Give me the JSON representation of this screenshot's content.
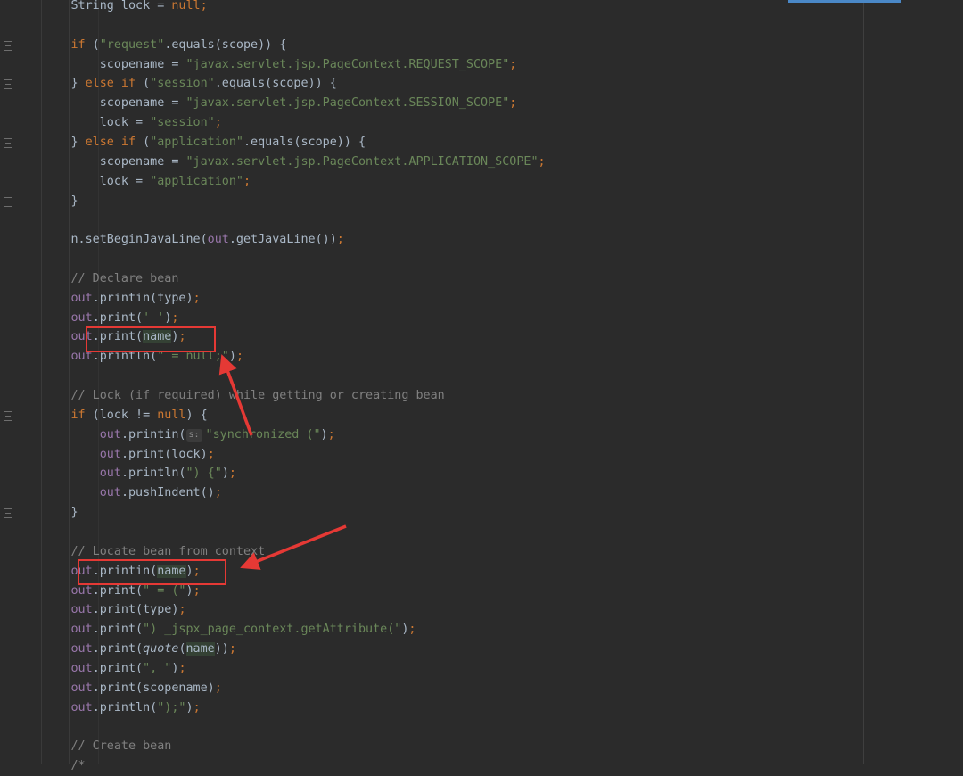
{
  "editor": {
    "language": "java",
    "theme_colors": {
      "background": "#2b2b2b",
      "keyword": "#cc7832",
      "string": "#6a8759",
      "field": "#9876aa",
      "comment": "#808080",
      "plain": "#a9b7c6",
      "annotation": "#e53935"
    },
    "lines": [
      {
        "fold": false,
        "tokens": [
          {
            "t": "plain",
            "v": "        String lock = "
          },
          {
            "t": "kw",
            "v": "null"
          },
          {
            "t": "kw",
            "v": ";"
          }
        ]
      },
      {
        "fold": false,
        "tokens": []
      },
      {
        "fold": true,
        "tokens": [
          {
            "t": "plain",
            "v": "        "
          },
          {
            "t": "kw",
            "v": "if"
          },
          {
            "t": "plain",
            "v": " ("
          },
          {
            "t": "str",
            "v": "\"request\""
          },
          {
            "t": "plain",
            "v": ".equals(scope)) {"
          }
        ]
      },
      {
        "fold": false,
        "tokens": [
          {
            "t": "plain",
            "v": "            scopename = "
          },
          {
            "t": "str",
            "v": "\"javax.servlet.jsp.PageContext.REQUEST_SCOPE\""
          },
          {
            "t": "kw",
            "v": ";"
          }
        ]
      },
      {
        "fold": true,
        "tokens": [
          {
            "t": "plain",
            "v": "        } "
          },
          {
            "t": "kw",
            "v": "else if"
          },
          {
            "t": "plain",
            "v": " ("
          },
          {
            "t": "str",
            "v": "\"session\""
          },
          {
            "t": "plain",
            "v": ".equals(scope)) {"
          }
        ]
      },
      {
        "fold": false,
        "tokens": [
          {
            "t": "plain",
            "v": "            scopename = "
          },
          {
            "t": "str",
            "v": "\"javax.servlet.jsp.PageContext.SESSION_SCOPE\""
          },
          {
            "t": "kw",
            "v": ";"
          }
        ]
      },
      {
        "fold": false,
        "tokens": [
          {
            "t": "plain",
            "v": "            lock = "
          },
          {
            "t": "str",
            "v": "\"session\""
          },
          {
            "t": "kw",
            "v": ";"
          }
        ]
      },
      {
        "fold": true,
        "tokens": [
          {
            "t": "plain",
            "v": "        } "
          },
          {
            "t": "kw",
            "v": "else if"
          },
          {
            "t": "plain",
            "v": " ("
          },
          {
            "t": "str",
            "v": "\"application\""
          },
          {
            "t": "plain",
            "v": ".equals(scope)) {"
          }
        ]
      },
      {
        "fold": false,
        "tokens": [
          {
            "t": "plain",
            "v": "            scopename = "
          },
          {
            "t": "str",
            "v": "\"javax.servlet.jsp.PageContext.APPLICATION_SCOPE\""
          },
          {
            "t": "kw",
            "v": ";"
          }
        ]
      },
      {
        "fold": false,
        "tokens": [
          {
            "t": "plain",
            "v": "            lock = "
          },
          {
            "t": "str",
            "v": "\"application\""
          },
          {
            "t": "kw",
            "v": ";"
          }
        ]
      },
      {
        "fold": true,
        "tokens": [
          {
            "t": "plain",
            "v": "        }"
          }
        ]
      },
      {
        "fold": false,
        "tokens": []
      },
      {
        "fold": false,
        "tokens": [
          {
            "t": "plain",
            "v": "        n.setBeginJavaLine("
          },
          {
            "t": "field",
            "v": "out"
          },
          {
            "t": "plain",
            "v": ".getJavaLine())"
          },
          {
            "t": "kw",
            "v": ";"
          }
        ]
      },
      {
        "fold": false,
        "tokens": []
      },
      {
        "fold": false,
        "tokens": [
          {
            "t": "comment",
            "v": "        // Declare bean"
          }
        ]
      },
      {
        "fold": false,
        "tokens": [
          {
            "t": "plain",
            "v": "        "
          },
          {
            "t": "field",
            "v": "out"
          },
          {
            "t": "plain",
            "v": ".printin(type)"
          },
          {
            "t": "kw",
            "v": ";"
          }
        ]
      },
      {
        "fold": false,
        "tokens": [
          {
            "t": "plain",
            "v": "        "
          },
          {
            "t": "field",
            "v": "out"
          },
          {
            "t": "plain",
            "v": ".print("
          },
          {
            "t": "str",
            "v": "' '"
          },
          {
            "t": "plain",
            "v": ")"
          },
          {
            "t": "kw",
            "v": ";"
          }
        ]
      },
      {
        "fold": false,
        "tokens": [
          {
            "t": "plain",
            "v": "        "
          },
          {
            "t": "field",
            "v": "out"
          },
          {
            "t": "plain",
            "v": ".print("
          },
          {
            "t": "hl",
            "v": "name"
          },
          {
            "t": "plain",
            "v": ")"
          },
          {
            "t": "kw",
            "v": ";"
          }
        ]
      },
      {
        "fold": false,
        "tokens": [
          {
            "t": "plain",
            "v": "        "
          },
          {
            "t": "field",
            "v": "out"
          },
          {
            "t": "plain",
            "v": ".println("
          },
          {
            "t": "str",
            "v": "\" = null;\""
          },
          {
            "t": "plain",
            "v": ")"
          },
          {
            "t": "kw",
            "v": ";"
          }
        ]
      },
      {
        "fold": false,
        "tokens": []
      },
      {
        "fold": false,
        "tokens": [
          {
            "t": "comment",
            "v": "        // Lock (if required) while getting or creating bean"
          }
        ]
      },
      {
        "fold": true,
        "tokens": [
          {
            "t": "plain",
            "v": "        "
          },
          {
            "t": "kw",
            "v": "if"
          },
          {
            "t": "plain",
            "v": " (lock != "
          },
          {
            "t": "kw",
            "v": "null"
          },
          {
            "t": "plain",
            "v": ") {"
          }
        ]
      },
      {
        "fold": false,
        "tokens": [
          {
            "t": "plain",
            "v": "            "
          },
          {
            "t": "field",
            "v": "out"
          },
          {
            "t": "plain",
            "v": ".printin("
          },
          {
            "t": "hint",
            "v": "s:"
          },
          {
            "t": "str",
            "v": "\"synchronized (\""
          },
          {
            "t": "plain",
            "v": ")"
          },
          {
            "t": "kw",
            "v": ";"
          }
        ]
      },
      {
        "fold": false,
        "tokens": [
          {
            "t": "plain",
            "v": "            "
          },
          {
            "t": "field",
            "v": "out"
          },
          {
            "t": "plain",
            "v": ".print(lock)"
          },
          {
            "t": "kw",
            "v": ";"
          }
        ]
      },
      {
        "fold": false,
        "tokens": [
          {
            "t": "plain",
            "v": "            "
          },
          {
            "t": "field",
            "v": "out"
          },
          {
            "t": "plain",
            "v": ".println("
          },
          {
            "t": "str",
            "v": "\") {\""
          },
          {
            "t": "plain",
            "v": ")"
          },
          {
            "t": "kw",
            "v": ";"
          }
        ]
      },
      {
        "fold": false,
        "tokens": [
          {
            "t": "plain",
            "v": "            "
          },
          {
            "t": "field",
            "v": "out"
          },
          {
            "t": "plain",
            "v": ".pushIndent()"
          },
          {
            "t": "kw",
            "v": ";"
          }
        ]
      },
      {
        "fold": true,
        "tokens": [
          {
            "t": "plain",
            "v": "        }"
          }
        ]
      },
      {
        "fold": false,
        "tokens": []
      },
      {
        "fold": false,
        "tokens": [
          {
            "t": "comment",
            "v": "        // Locate bean from context"
          }
        ]
      },
      {
        "fold": false,
        "tokens": [
          {
            "t": "plain",
            "v": "        "
          },
          {
            "t": "field",
            "v": "out"
          },
          {
            "t": "plain",
            "v": ".printin("
          },
          {
            "t": "hl",
            "v": "name"
          },
          {
            "t": "plain",
            "v": ")"
          },
          {
            "t": "kw",
            "v": ";"
          }
        ]
      },
      {
        "fold": false,
        "tokens": [
          {
            "t": "plain",
            "v": "        "
          },
          {
            "t": "field",
            "v": "out"
          },
          {
            "t": "plain",
            "v": ".print("
          },
          {
            "t": "str",
            "v": "\" = (\""
          },
          {
            "t": "plain",
            "v": ")"
          },
          {
            "t": "kw",
            "v": ";"
          }
        ]
      },
      {
        "fold": false,
        "tokens": [
          {
            "t": "plain",
            "v": "        "
          },
          {
            "t": "field",
            "v": "out"
          },
          {
            "t": "plain",
            "v": ".print(type)"
          },
          {
            "t": "kw",
            "v": ";"
          }
        ]
      },
      {
        "fold": false,
        "tokens": [
          {
            "t": "plain",
            "v": "        "
          },
          {
            "t": "field",
            "v": "out"
          },
          {
            "t": "plain",
            "v": ".print("
          },
          {
            "t": "str",
            "v": "\") _jspx_page_context.getAttribute(\""
          },
          {
            "t": "plain",
            "v": ")"
          },
          {
            "t": "kw",
            "v": ";"
          }
        ]
      },
      {
        "fold": false,
        "tokens": [
          {
            "t": "plain",
            "v": "        "
          },
          {
            "t": "field",
            "v": "out"
          },
          {
            "t": "plain",
            "v": ".print("
          },
          {
            "t": "italic",
            "v": "quote"
          },
          {
            "t": "plain",
            "v": "("
          },
          {
            "t": "hl",
            "v": "name"
          },
          {
            "t": "plain",
            "v": "))"
          },
          {
            "t": "kw",
            "v": ";"
          }
        ]
      },
      {
        "fold": false,
        "tokens": [
          {
            "t": "plain",
            "v": "        "
          },
          {
            "t": "field",
            "v": "out"
          },
          {
            "t": "plain",
            "v": ".print("
          },
          {
            "t": "str",
            "v": "\", \""
          },
          {
            "t": "plain",
            "v": ")"
          },
          {
            "t": "kw",
            "v": ";"
          }
        ]
      },
      {
        "fold": false,
        "tokens": [
          {
            "t": "plain",
            "v": "        "
          },
          {
            "t": "field",
            "v": "out"
          },
          {
            "t": "plain",
            "v": ".print(scopename)"
          },
          {
            "t": "kw",
            "v": ";"
          }
        ]
      },
      {
        "fold": false,
        "tokens": [
          {
            "t": "plain",
            "v": "        "
          },
          {
            "t": "field",
            "v": "out"
          },
          {
            "t": "plain",
            "v": ".println("
          },
          {
            "t": "str",
            "v": "\");\""
          },
          {
            "t": "plain",
            "v": ")"
          },
          {
            "t": "kw",
            "v": ";"
          }
        ]
      },
      {
        "fold": false,
        "tokens": []
      },
      {
        "fold": false,
        "tokens": [
          {
            "t": "comment",
            "v": "        // Create bean"
          }
        ]
      },
      {
        "fold": false,
        "tokens": [
          {
            "t": "comment",
            "v": "        /*"
          }
        ]
      }
    ]
  },
  "annotations": [
    {
      "kind": "highlight-box",
      "target": "out.print(name);"
    },
    {
      "kind": "highlight-box",
      "target": "out.printin(name);"
    },
    {
      "kind": "arrow"
    },
    {
      "kind": "arrow"
    }
  ]
}
